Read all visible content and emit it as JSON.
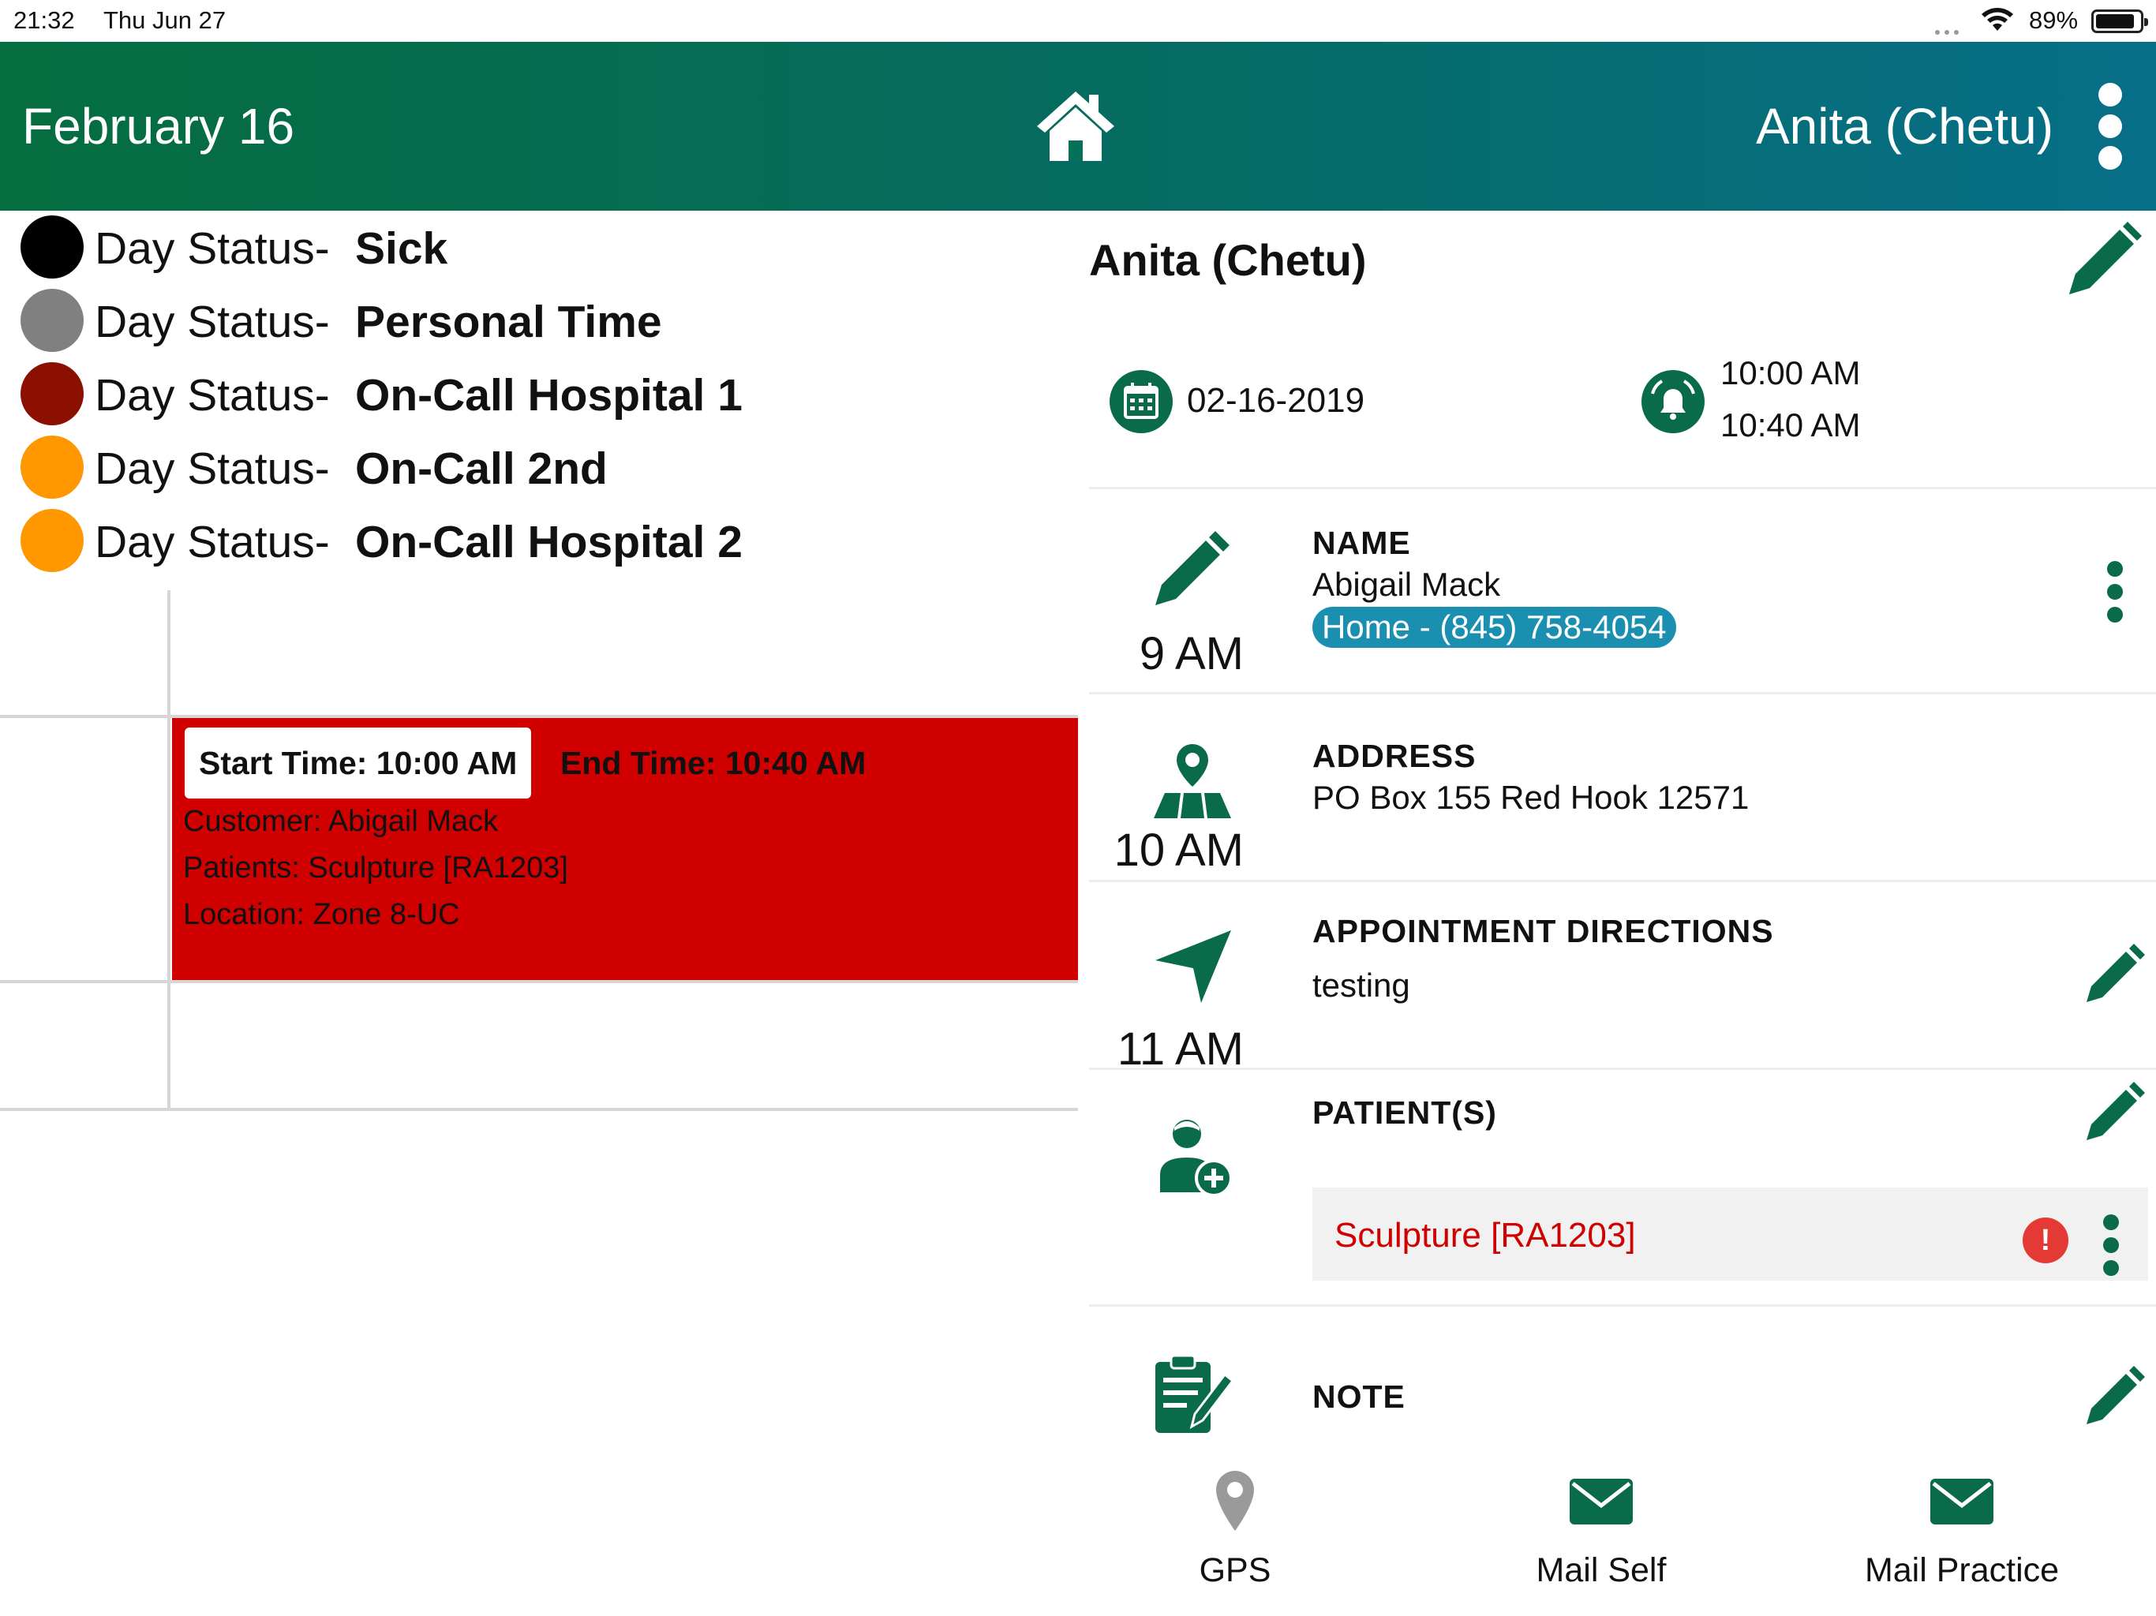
{
  "status_bar": {
    "time": "21:32",
    "date": "Thu Jun 27",
    "battery": "89%"
  },
  "header": {
    "date": "February 16",
    "user": "Anita (Chetu)"
  },
  "day_statuses": [
    {
      "prefix": "Day Status-",
      "label": "Sick",
      "color": "#000000"
    },
    {
      "prefix": "Day Status-",
      "label": "Personal Time",
      "color": "#808080"
    },
    {
      "prefix": "Day Status-",
      "label": "On-Call Hospital 1",
      "color": "#8b1000"
    },
    {
      "prefix": "Day Status-",
      "label": "On-Call 2nd",
      "color": "#ff9800"
    },
    {
      "prefix": "Day Status-",
      "label": "On-Call Hospital 2",
      "color": "#ff9800"
    }
  ],
  "schedule": {
    "hours": [
      "9 AM",
      "10 AM",
      "11 AM"
    ],
    "event": {
      "start": "Start Time: 10:00 AM",
      "end": "End Time: 10:40 AM",
      "customer": "Customer: Abigail Mack",
      "patients": "Patients: Sculpture [RA1203]",
      "location": "Location: Zone 8-UC",
      "color": "#d10000"
    }
  },
  "detail": {
    "title": "Anita (Chetu)",
    "date": "02-16-2019",
    "time_start": "10:00 AM",
    "time_end": "10:40 AM",
    "name_label": "NAME",
    "name_value": "Abigail Mack",
    "phone": "Home - (845) 758-4054",
    "address_label": "ADDRESS",
    "address_value": "PO Box 155  Red Hook 12571",
    "directions_label": "APPOINTMENT DIRECTIONS",
    "directions_value": "testing",
    "patients_label": "PATIENT(S)",
    "patient_name": "Sculpture [RA1203]",
    "patient_alert": "!",
    "note_label": "NOTE"
  },
  "tabbar": {
    "gps": "GPS",
    "mail_self": "Mail Self",
    "mail_practice": "Mail Practice"
  },
  "colors": {
    "accent": "#0a6b4a",
    "header_start": "#056d3f",
    "header_end": "#066f88",
    "event": "#d10000",
    "phone_chip": "#1a8fb0"
  }
}
